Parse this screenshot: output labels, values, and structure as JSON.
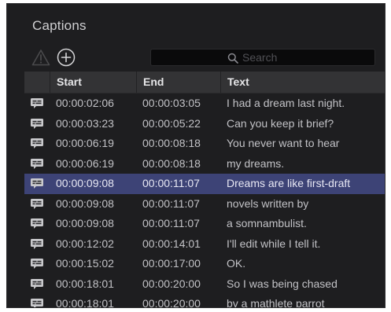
{
  "panel": {
    "title": "Captions"
  },
  "toolbar": {
    "warning_icon": "warning-triangle-icon",
    "add_icon": "add-circle-icon",
    "search": {
      "placeholder": "Search",
      "value": ""
    }
  },
  "table": {
    "columns": [
      "",
      "Start",
      "End",
      "Text"
    ],
    "rows": [
      {
        "start": "00:00:02:06",
        "end": "00:00:03:05",
        "text": "I had a dream last night.",
        "selected": false
      },
      {
        "start": "00:00:03:23",
        "end": "00:00:05:22",
        "text": "Can you keep it brief?",
        "selected": false
      },
      {
        "start": "00:00:06:19",
        "end": "00:00:08:18",
        "text": "You never want to hear",
        "selected": false
      },
      {
        "start": "00:00:06:19",
        "end": "00:00:08:18",
        "text": "my dreams.",
        "selected": false
      },
      {
        "start": "00:00:09:08",
        "end": "00:00:11:07",
        "text": "Dreams are like first-draft",
        "selected": true
      },
      {
        "start": "00:00:09:08",
        "end": "00:00:11:07",
        "text": "novels written by",
        "selected": false
      },
      {
        "start": "00:00:09:08",
        "end": "00:00:11:07",
        "text": "a somnambulist.",
        "selected": false
      },
      {
        "start": "00:00:12:02",
        "end": "00:00:14:01",
        "text": "I'll edit while I tell it.",
        "selected": false
      },
      {
        "start": "00:00:15:02",
        "end": "00:00:17:00",
        "text": "OK.",
        "selected": false
      },
      {
        "start": "00:00:18:01",
        "end": "00:00:20:00",
        "text": "So I was being chased",
        "selected": false
      },
      {
        "start": "00:00:18:01",
        "end": "00:00:20:00",
        "text": "by a mathlete parrot",
        "selected": false
      }
    ]
  },
  "colors": {
    "panel_bg": "#1e1e20",
    "header_bg": "#333335",
    "selection": "#3d4376",
    "text": "#c2c2c6",
    "caption_icon": "#c9c9cc"
  }
}
